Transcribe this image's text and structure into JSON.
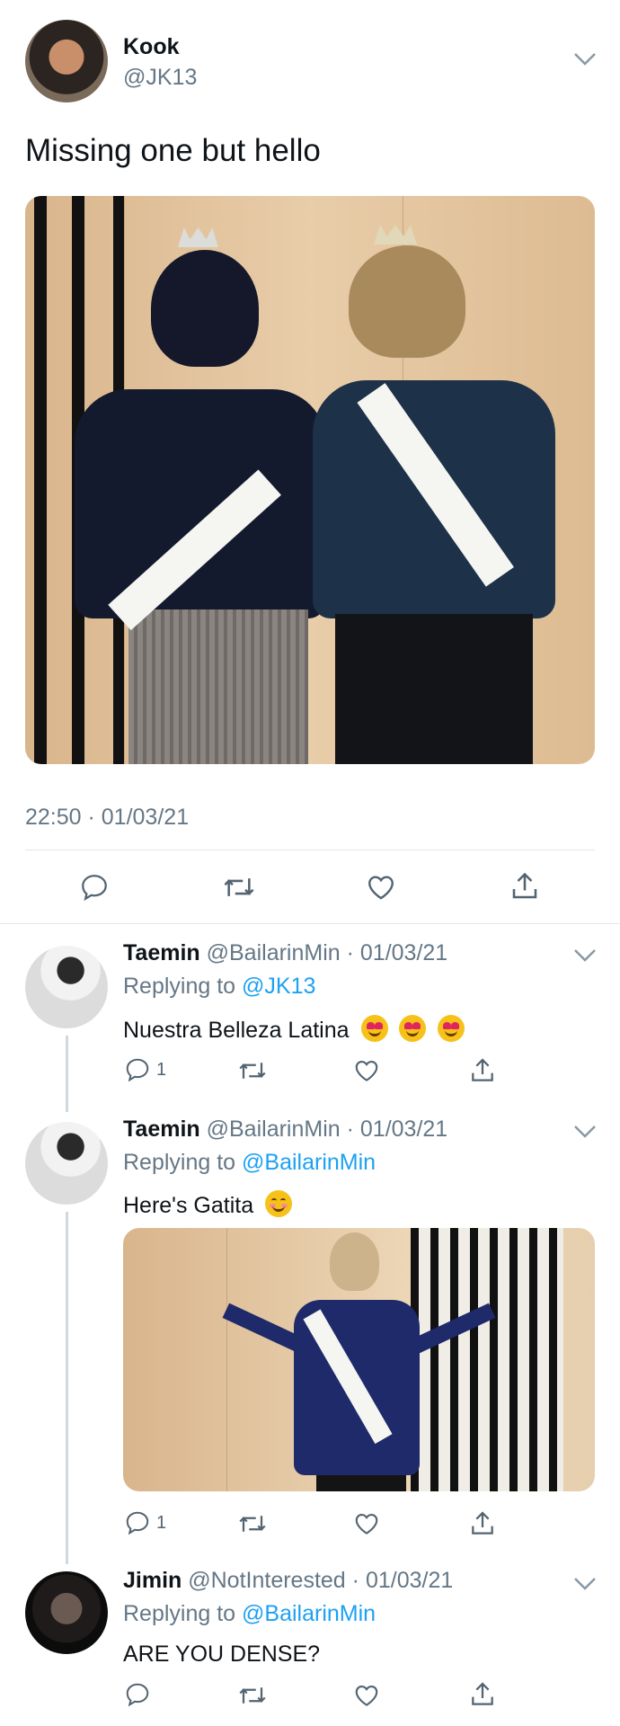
{
  "main_tweet": {
    "name": "Kook",
    "handle": "@JK13",
    "text": "Missing one but hello",
    "timestamp": "22:50 · 01/03/21"
  },
  "replies": [
    {
      "name": "Taemin",
      "handle": "@BailarinMin",
      "date": "· 01/03/21",
      "replying_prefix": "Replying to",
      "replying_to": "@JK13",
      "text": "Nuestra Belleza Latina",
      "emoji": "heart-eyes-emoji",
      "reply_count": "1"
    },
    {
      "name": "Taemin",
      "handle": "@BailarinMin",
      "date": "· 01/03/21",
      "replying_prefix": "Replying to",
      "replying_to": "@BailarinMin",
      "text": "Here's Gatita",
      "emoji": "blush-emoji",
      "reply_count": "1"
    },
    {
      "name": "Jimin",
      "handle": "@NotInterested",
      "date": "· 01/03/21",
      "replying_prefix": "Replying to",
      "replying_to": "@BailarinMin",
      "text": "ARE YOU DENSE?",
      "reply_count": ""
    }
  ],
  "colors": {
    "link": "#1da1f2",
    "muted": "#657786",
    "divider": "#e1e8ed"
  }
}
